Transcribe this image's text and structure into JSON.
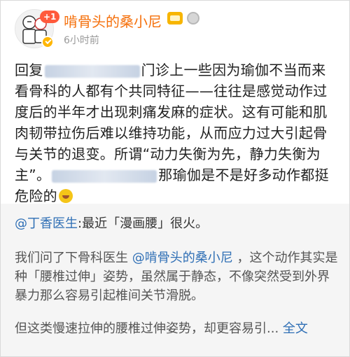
{
  "header": {
    "username": "啃骨头的桑小尼",
    "badge_count": "+1",
    "post_time": "6小时前"
  },
  "post": {
    "t1": "回复",
    "t2": "门诊上一些因为瑜伽不当而来看骨科的人都有个共同特征——往往是感觉动作过度后的半年才出现刺痛发麻的症状。这有可能和肌肉韧带拉伤后难以维持功能，从而应力过大引起骨与关节的退变。所谓“动力失衡为先，静力失衡为主”。",
    "t3": "那瑜伽是不是好多动作都挺危险的"
  },
  "quote": {
    "author": "@丁香医生",
    "line1": ":最近「漫画腰」很火。",
    "p2a": "我们问了下骨科医生 ",
    "p2_mention": "@啃骨头的桑小尼",
    "p2b": " ，这个动作其实是种「腰椎过伸」姿势，虽然属于静态，不像突然受到外界暴力那么容易引起椎间关节滑脱。",
    "line3": "但这类慢速拉伸的腰椎过伸姿势，却更容易引...",
    "fulltext": " 全文"
  },
  "colors": {
    "username": "#f56f0a",
    "link": "#2f6fb5",
    "quote_bg": "#f5f5f5"
  },
  "icons": [
    "avatar",
    "verified-icon",
    "vip-icon",
    "medal-icon",
    "laugh-icon"
  ]
}
